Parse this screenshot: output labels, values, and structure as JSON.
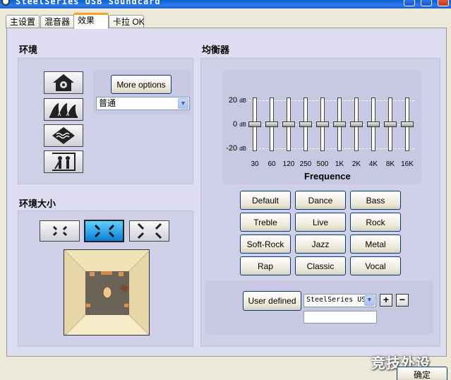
{
  "window": {
    "title": "SteelSeries USB Soundcard"
  },
  "tabs": [
    {
      "label": "主设置"
    },
    {
      "label": "混音器"
    },
    {
      "label": "效果"
    },
    {
      "label": "卡拉 OK"
    }
  ],
  "environment": {
    "title": "环境",
    "icons": [
      "studio-house-icon",
      "opera-house-icon",
      "underwater-icon",
      "stage-figures-icon"
    ],
    "more_options_label": "More options",
    "preset_select": "普通"
  },
  "env_size": {
    "title": "环境大小",
    "size_buttons": [
      "small-room-icon",
      "medium-room-icon",
      "large-room-icon"
    ],
    "selected_size": 1
  },
  "equalizer": {
    "title": "均衡器",
    "db_labels": [
      {
        "value": "20",
        "unit": "dB"
      },
      {
        "value": "0",
        "unit": "dB"
      },
      {
        "value": "-20",
        "unit": "dB"
      }
    ],
    "bands": [
      "30",
      "60",
      "120",
      "250",
      "500",
      "1K",
      "2K",
      "4K",
      "8K",
      "16K"
    ],
    "band_gains_db": [
      0,
      0,
      0,
      0,
      0,
      0,
      0,
      0,
      0,
      0
    ],
    "frequence_label": "Frequence",
    "presets": [
      "Default",
      "Dance",
      "Bass",
      "Treble",
      "Live",
      "Rock",
      "Soft-Rock",
      "Jazz",
      "Metal",
      "Rap",
      "Classic",
      "Vocal"
    ],
    "user_defined_label": "User defined",
    "user_preset_select": "SteelSeries US",
    "add_label": "+",
    "remove_label": "−",
    "preset_name_value": ""
  },
  "footer": {
    "ok_label": "确定",
    "watermark": "竞技外设"
  }
}
